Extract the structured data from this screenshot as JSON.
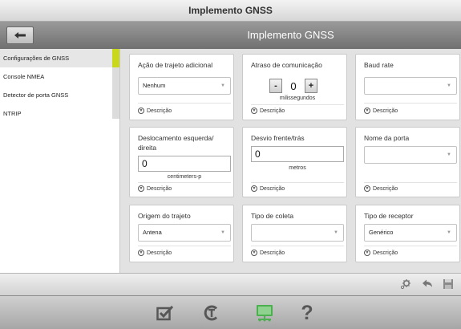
{
  "window_title": "Implemento GNSS",
  "header": {
    "title": "Implemento GNSS",
    "back_icon": "back-arrow-icon"
  },
  "sidebar": {
    "items": [
      {
        "label": "Configurações de GNSS",
        "active": true
      },
      {
        "label": "Console NMEA",
        "active": false
      },
      {
        "label": "Detector de porta GNSS",
        "active": false
      },
      {
        "label": "NTRIP",
        "active": false
      }
    ]
  },
  "cards": {
    "path_action": {
      "title": "Ação de trajeto adicional",
      "value": "Nenhum"
    },
    "comm_delay": {
      "title": "Atraso de comunicação",
      "value": "0",
      "unit": "milissegundos",
      "minus": "-",
      "plus": "+"
    },
    "baud_rate": {
      "title": "Baud rate",
      "value": ""
    },
    "offset_lr": {
      "title": "Deslocamento esquerda/ direita",
      "value": "0",
      "unit": "centimeters-p"
    },
    "offset_fb": {
      "title": "Desvio frente/trás",
      "value": "0",
      "unit": "metros"
    },
    "port_name": {
      "title": "Nome da porta",
      "value": ""
    },
    "path_origin": {
      "title": "Origem do trajeto",
      "value": "Antena"
    },
    "collect_type": {
      "title": "Tipo de coleta",
      "value": ""
    },
    "receiver_type": {
      "title": "Tipo de receptor",
      "value": "Genérico"
    }
  },
  "description_label": "Descrição",
  "colors": {
    "accent": "#c9d81a",
    "header": "#8a8a8a",
    "active_nav": "#4caf50"
  },
  "action_icons": [
    "settings-gear-icon",
    "undo-arrow-icon",
    "save-disk-icon"
  ],
  "bottom_nav": [
    "checklist-icon",
    "calibration-c-icon",
    "gnss-network-icon",
    "help-icon"
  ],
  "help_glyph": "?"
}
